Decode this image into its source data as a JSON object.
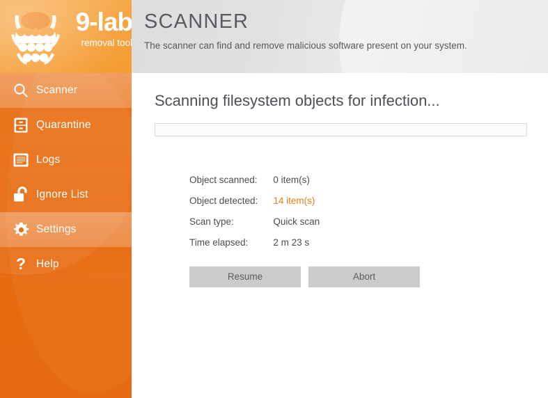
{
  "brand": {
    "name": "9-lab",
    "tagline": "removal tool",
    "logo_icon": "bug-icon",
    "accent_color": "#e8690e",
    "logo_bg_color": "#f5a33f"
  },
  "header": {
    "title": "SCANNER",
    "subtitle": "The scanner can find and remove malicious software present on your system."
  },
  "sidebar": {
    "items": [
      {
        "label": "Scanner",
        "icon": "search-icon",
        "active": true
      },
      {
        "label": "Quarantine",
        "icon": "cabinet-icon",
        "active": false
      },
      {
        "label": "Logs",
        "icon": "document-icon",
        "active": false
      },
      {
        "label": "Ignore List",
        "icon": "unlock-icon",
        "active": false
      },
      {
        "label": "Settings",
        "icon": "gear-icon",
        "active": true
      },
      {
        "label": "Help",
        "icon": "question-icon",
        "active": false
      }
    ]
  },
  "main": {
    "scan_heading": "Scanning filesystem objects for infection...",
    "progress": {
      "percent": 0,
      "fill_color": "#f0a23c"
    },
    "stats": [
      {
        "label": "Object scanned:",
        "value": "0 item(s)",
        "accent": false
      },
      {
        "label": "Object detected:",
        "value": "14 item(s)",
        "accent": true
      },
      {
        "label": "Scan type:",
        "value": "Quick scan",
        "accent": false
      },
      {
        "label": "Time elapsed:",
        "value": "2 m 23 s",
        "accent": false
      }
    ],
    "detected_color": "#e87b16",
    "buttons": [
      {
        "label": "Resume",
        "name": "resume-button"
      },
      {
        "label": "Abort",
        "name": "abort-button"
      }
    ]
  }
}
